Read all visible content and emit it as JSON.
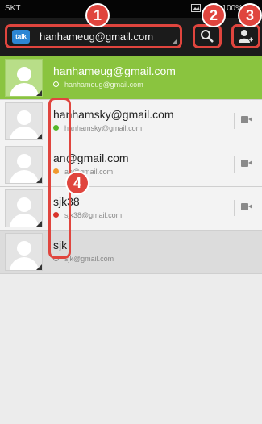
{
  "status_bar": {
    "carrier": "SKT",
    "battery_text": "100%"
  },
  "account": {
    "email": "hanhameug@gmail.com",
    "logo_text": "talk"
  },
  "badges": {
    "b1": "1",
    "b2": "2",
    "b3": "3",
    "b4": "4"
  },
  "contacts": [
    {
      "name": "hanhameug@gmail.com",
      "status": "hanhameug@gmail.com",
      "presence": "self"
    },
    {
      "name": "hanhamsky@gmail.com",
      "status": "hanhamsky@gmail.com",
      "presence": "available"
    },
    {
      "name": "an@gmail.com",
      "status": "an@gmail.com",
      "presence": "away"
    },
    {
      "name": "sjk38",
      "status": "sjk38@gmail.com",
      "presence": "busy"
    },
    {
      "name": "sjk",
      "status": "sjk@gmail.com",
      "presence": "offline"
    }
  ],
  "colors": {
    "accent": "#e0453e",
    "active_row": "#8ac43f",
    "action_bar": "#1b1b1b",
    "available": "#56b62b",
    "away": "#f0982e",
    "busy": "#d9342c"
  },
  "icons": {
    "search": "search-icon",
    "add_contact": "add-contact-icon",
    "video": "video-chat-icon"
  }
}
